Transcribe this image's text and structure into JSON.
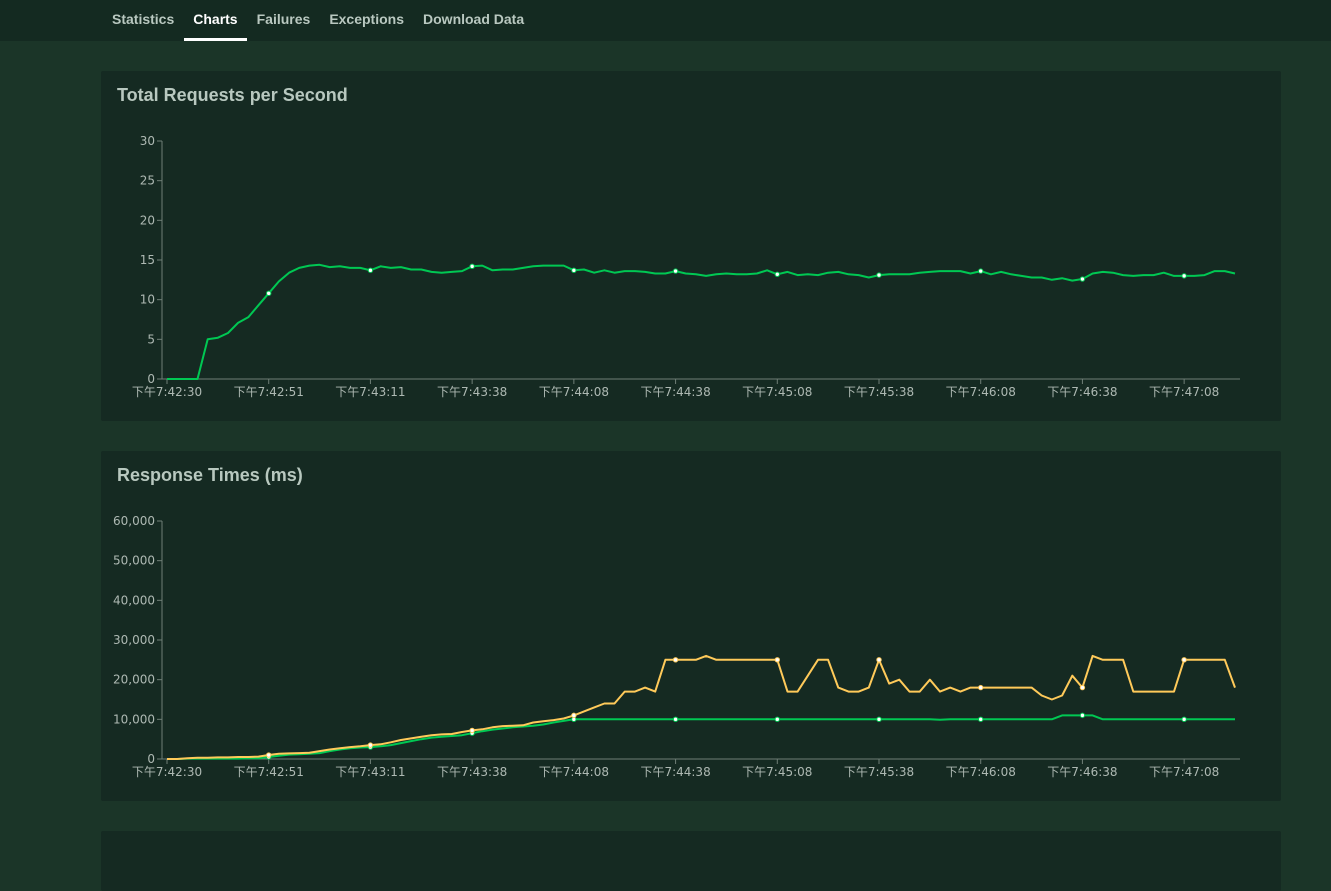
{
  "tabs": [
    {
      "label": "Statistics",
      "active": false
    },
    {
      "label": "Charts",
      "active": true
    },
    {
      "label": "Failures",
      "active": false
    },
    {
      "label": "Exceptions",
      "active": false
    },
    {
      "label": "Download Data",
      "active": false
    }
  ],
  "colors": {
    "page_bg": "#1b3528",
    "card_bg": "#152a22",
    "green": "#00c853",
    "yellow": "#ffca5a"
  },
  "chart_data": [
    {
      "type": "line",
      "title": "Total Requests per Second",
      "ylim": [
        0,
        30
      ],
      "yticks": [
        "0",
        "5",
        "10",
        "15",
        "20",
        "25",
        "30"
      ],
      "ytick_values": [
        0,
        5,
        10,
        15,
        20,
        25,
        30
      ],
      "xtick_labels": [
        "下午7:42:30",
        "下午7:42:51",
        "下午7:43:11",
        "下午7:43:38",
        "下午7:44:08",
        "下午7:44:38",
        "下午7:45:08",
        "下午7:45:38",
        "下午7:46:08",
        "下午7:46:38",
        "下午7:47:08"
      ],
      "series": [
        {
          "color": "#00c853",
          "values": [
            0,
            0,
            0,
            0,
            5,
            5.2,
            5.8,
            7.1,
            7.8,
            9.3,
            10.8,
            12.3,
            13.4,
            14.0,
            14.3,
            14.4,
            14.1,
            14.2,
            14.0,
            14.0,
            13.7,
            14.2,
            14.0,
            14.1,
            13.8,
            13.8,
            13.5,
            13.4,
            13.5,
            13.6,
            14.2,
            14.3,
            13.7,
            13.8,
            13.8,
            14.0,
            14.2,
            14.3,
            14.3,
            14.3,
            13.7,
            13.8,
            13.4,
            13.7,
            13.4,
            13.6,
            13.6,
            13.5,
            13.3,
            13.3,
            13.6,
            13.3,
            13.2,
            13.0,
            13.2,
            13.3,
            13.2,
            13.2,
            13.3,
            13.7,
            13.2,
            13.5,
            13.1,
            13.2,
            13.1,
            13.4,
            13.5,
            13.2,
            13.1,
            12.8,
            13.1,
            13.2,
            13.2,
            13.2,
            13.4,
            13.5,
            13.6,
            13.6,
            13.6,
            13.3,
            13.6,
            13.2,
            13.5,
            13.2,
            13.0,
            12.8,
            12.8,
            12.5,
            12.7,
            12.4,
            12.6,
            13.3,
            13.5,
            13.4,
            13.1,
            13.0,
            13.1,
            13.1,
            13.4,
            13.0,
            13.0,
            13.0,
            13.1,
            13.6,
            13.6,
            13.3
          ]
        }
      ]
    },
    {
      "type": "line",
      "title": "Response Times (ms)",
      "ylim": [
        0,
        60000
      ],
      "yticks": [
        "0",
        "10,000",
        "20,000",
        "30,000",
        "40,000",
        "50,000",
        "60,000"
      ],
      "ytick_values": [
        0,
        10000,
        20000,
        30000,
        40000,
        50000,
        60000
      ],
      "xtick_labels": [
        "下午7:42:30",
        "下午7:42:51",
        "下午7:43:11",
        "下午7:43:38",
        "下午7:44:08",
        "下午7:44:38",
        "下午7:45:08",
        "下午7:45:38",
        "下午7:46:08",
        "下午7:46:38",
        "下午7:47:08"
      ],
      "series": [
        {
          "color": "#00c853",
          "values": [
            0,
            0,
            100,
            100,
            100,
            100,
            100,
            100,
            200,
            200,
            500,
            800,
            1100,
            1200,
            1300,
            1500,
            2000,
            2400,
            2700,
            2900,
            3000,
            3200,
            3500,
            4000,
            4500,
            5000,
            5400,
            5600,
            5800,
            6000,
            6500,
            7000,
            7400,
            7700,
            8000,
            8200,
            8400,
            8700,
            9200,
            9600,
            10000,
            10000,
            10000,
            10000,
            10000,
            10000,
            10000,
            10000,
            10000,
            10000,
            10000,
            10000,
            10000,
            10000,
            10000,
            10000,
            10000,
            10000,
            10000,
            10000,
            10000,
            10000,
            10000,
            10000,
            10000,
            10000,
            10000,
            10000,
            10000,
            10000,
            10000,
            10000,
            10000,
            10000,
            10000,
            10000,
            9900,
            10000,
            10000,
            10000,
            10000,
            10000,
            10000,
            10000,
            10000,
            10000,
            10000,
            10000,
            11000,
            11000,
            11000,
            11000,
            10000,
            10000,
            10000,
            10000,
            10000,
            10000,
            10000,
            10000,
            10000,
            10000,
            10000,
            10000,
            10000,
            10000
          ]
        },
        {
          "color": "#ffca5a",
          "values": [
            0,
            0,
            200,
            300,
            300,
            400,
            400,
            500,
            500,
            600,
            1000,
            1300,
            1400,
            1500,
            1600,
            2000,
            2400,
            2700,
            3000,
            3200,
            3500,
            3700,
            4200,
            4800,
            5200,
            5600,
            6000,
            6200,
            6300,
            6800,
            7200,
            7500,
            8000,
            8300,
            8400,
            8500,
            9200,
            9500,
            9800,
            10200,
            11000,
            12000,
            13000,
            14000,
            14000,
            17000,
            17000,
            18000,
            17000,
            25000,
            25000,
            25000,
            25000,
            26000,
            25000,
            25000,
            25000,
            25000,
            25000,
            25000,
            25000,
            17000,
            17000,
            21000,
            25000,
            25000,
            18000,
            17000,
            17000,
            18000,
            25000,
            19000,
            20000,
            17000,
            17000,
            20000,
            17000,
            18000,
            17000,
            18000,
            18000,
            18000,
            18000,
            18000,
            18000,
            18000,
            16000,
            15000,
            16000,
            21000,
            18000,
            26000,
            25000,
            25000,
            25000,
            17000,
            17000,
            17000,
            17000,
            17000,
            25000,
            25000,
            25000,
            25000,
            25000,
            18000
          ]
        }
      ]
    }
  ]
}
